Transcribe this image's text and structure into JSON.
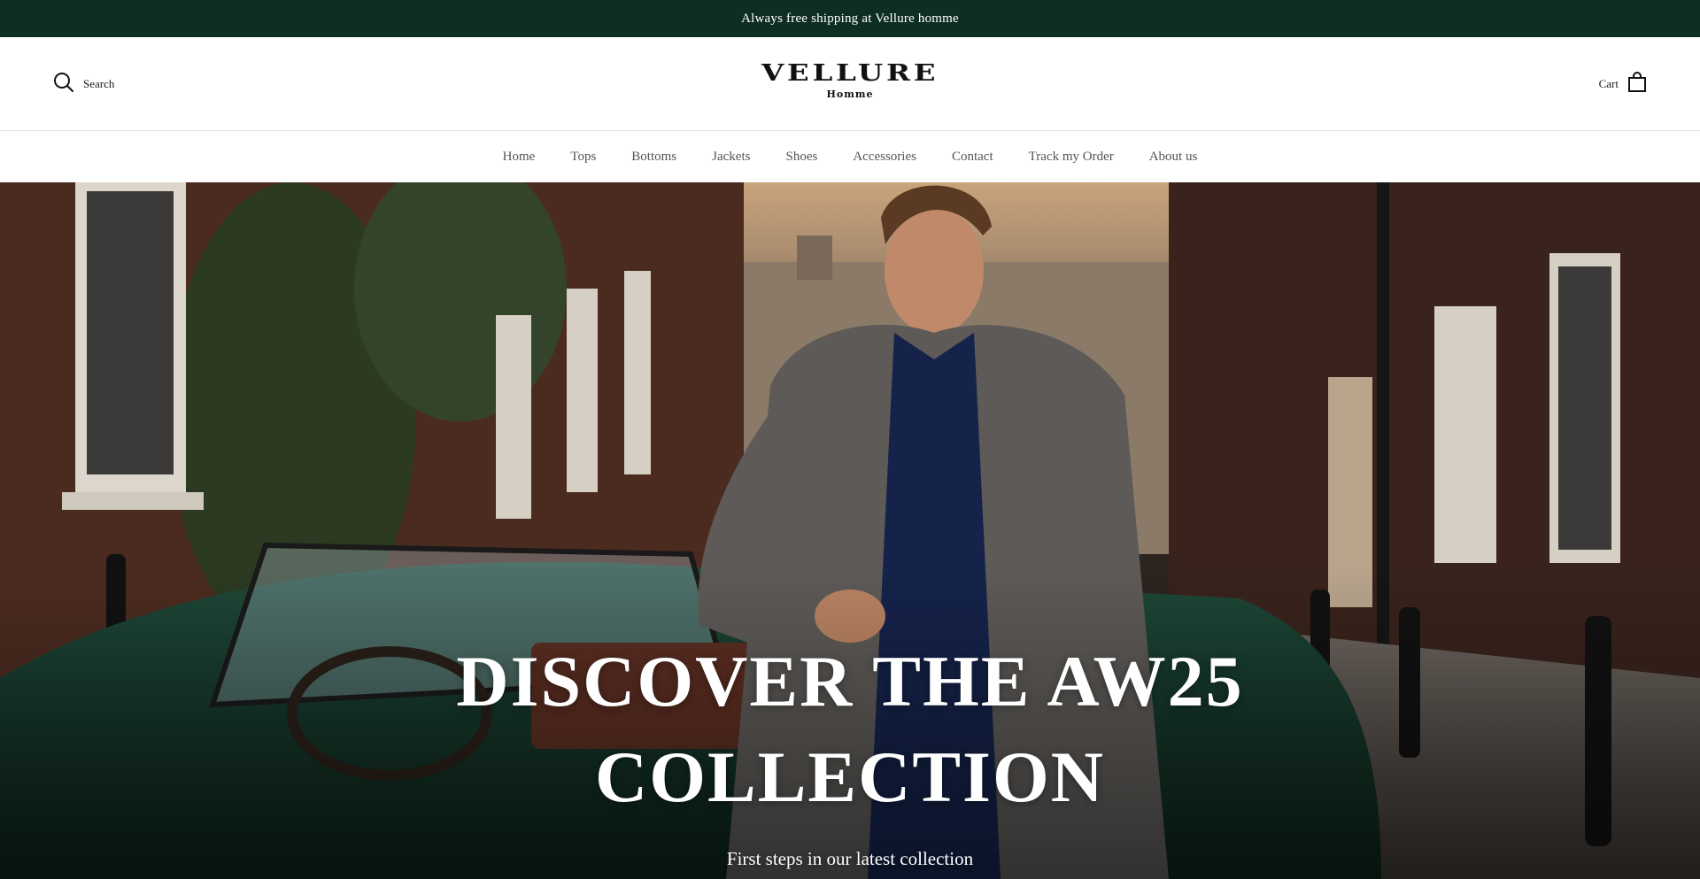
{
  "announcement": {
    "text": "Always free shipping at Vellure homme"
  },
  "header": {
    "search_label": "Search",
    "logo": {
      "name": "VELLURE",
      "sub": "Homme"
    },
    "cart_label": "Cart"
  },
  "nav": {
    "items": [
      {
        "label": "Home"
      },
      {
        "label": "Tops"
      },
      {
        "label": "Bottoms"
      },
      {
        "label": "Jackets"
      },
      {
        "label": "Shoes"
      },
      {
        "label": "Accessories"
      },
      {
        "label": "Contact"
      },
      {
        "label": "Track my Order"
      },
      {
        "label": "About us"
      }
    ]
  },
  "hero": {
    "title": "DISCOVER THE AW25 COLLECTION",
    "subtitle": "First steps in our latest collection",
    "image": "man-in-tweed-coat-leaning-on-green-convertible-on-brick-street"
  },
  "colors": {
    "announcement_bg": "#0e2e22",
    "text_dark": "#1a1a1a",
    "nav_text": "#555555",
    "hero_text": "#ffffff"
  }
}
